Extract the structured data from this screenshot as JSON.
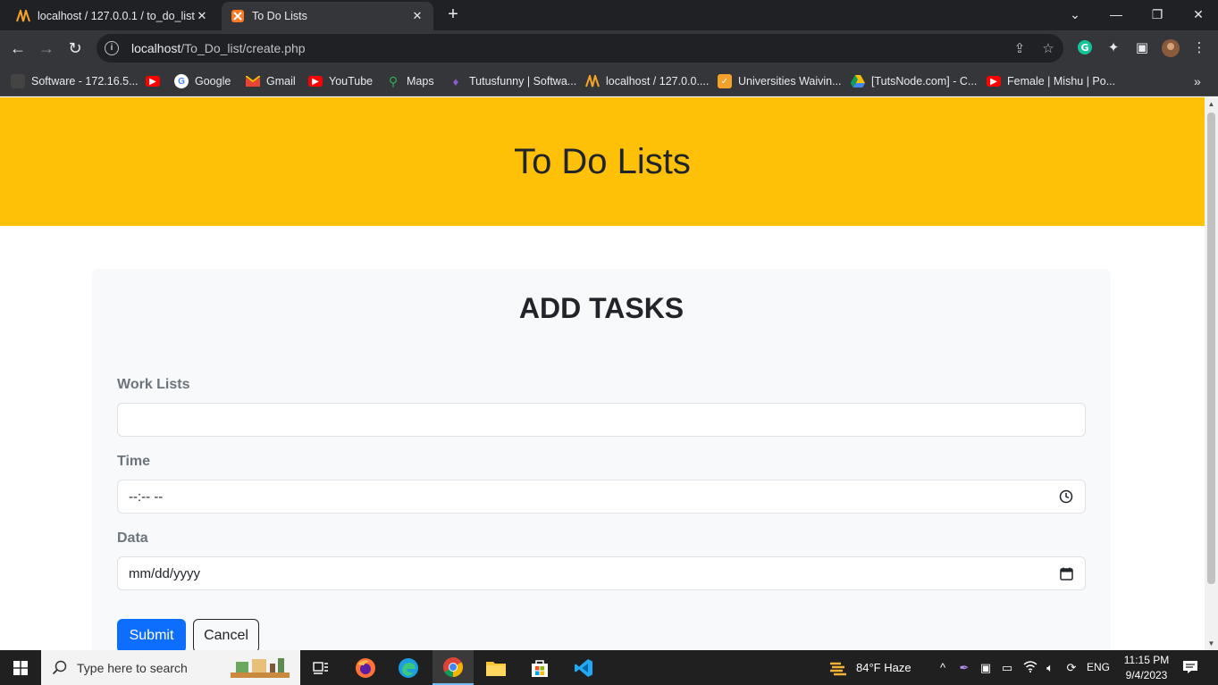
{
  "browser": {
    "tabs": [
      {
        "title": "localhost / 127.0.0.1 / to_do_list /",
        "favicon": "phpmyadmin-icon",
        "active": false
      },
      {
        "title": "To Do Lists",
        "favicon": "xampp-icon",
        "active": true
      }
    ],
    "address_bar": {
      "host": "localhost",
      "path": "/To_Do_list/create.php"
    },
    "bookmarks": [
      {
        "label": "Software - 172.16.5...",
        "icon": "folder-icon"
      },
      {
        "label": "",
        "icon": "youtube-icon"
      },
      {
        "label": "Google",
        "icon": "google-icon"
      },
      {
        "label": "Gmail",
        "icon": "gmail-icon"
      },
      {
        "label": "YouTube",
        "icon": "youtube-icon"
      },
      {
        "label": "Maps",
        "icon": "maps-icon"
      },
      {
        "label": "Tutusfunny | Softwa...",
        "icon": "tutusfunny-icon"
      },
      {
        "label": "localhost / 127.0.0....",
        "icon": "phpmyadmin-icon"
      },
      {
        "label": "Universities Waivin...",
        "icon": "universities-icon"
      },
      {
        "label": "[TutsNode.com] - C...",
        "icon": "drive-icon"
      },
      {
        "label": "Female | Mishu | Po...",
        "icon": "youtube-icon"
      }
    ]
  },
  "page": {
    "header_title": "To Do Lists",
    "form_title": "ADD TASKS",
    "fields": {
      "work": {
        "label": "Work Lists",
        "value": ""
      },
      "time": {
        "label": "Time",
        "value": "--:-- --"
      },
      "date": {
        "label": "Data",
        "value": "mm/dd/yyyy"
      }
    },
    "buttons": {
      "submit": "Submit",
      "cancel": "Cancel"
    }
  },
  "taskbar": {
    "search_placeholder": "Type here to search",
    "weather": "84°F  Haze",
    "language": "ENG",
    "time": "11:15 PM",
    "date": "9/4/2023"
  },
  "colors": {
    "hero": "#ffc107",
    "primary": "#0d6efd"
  }
}
